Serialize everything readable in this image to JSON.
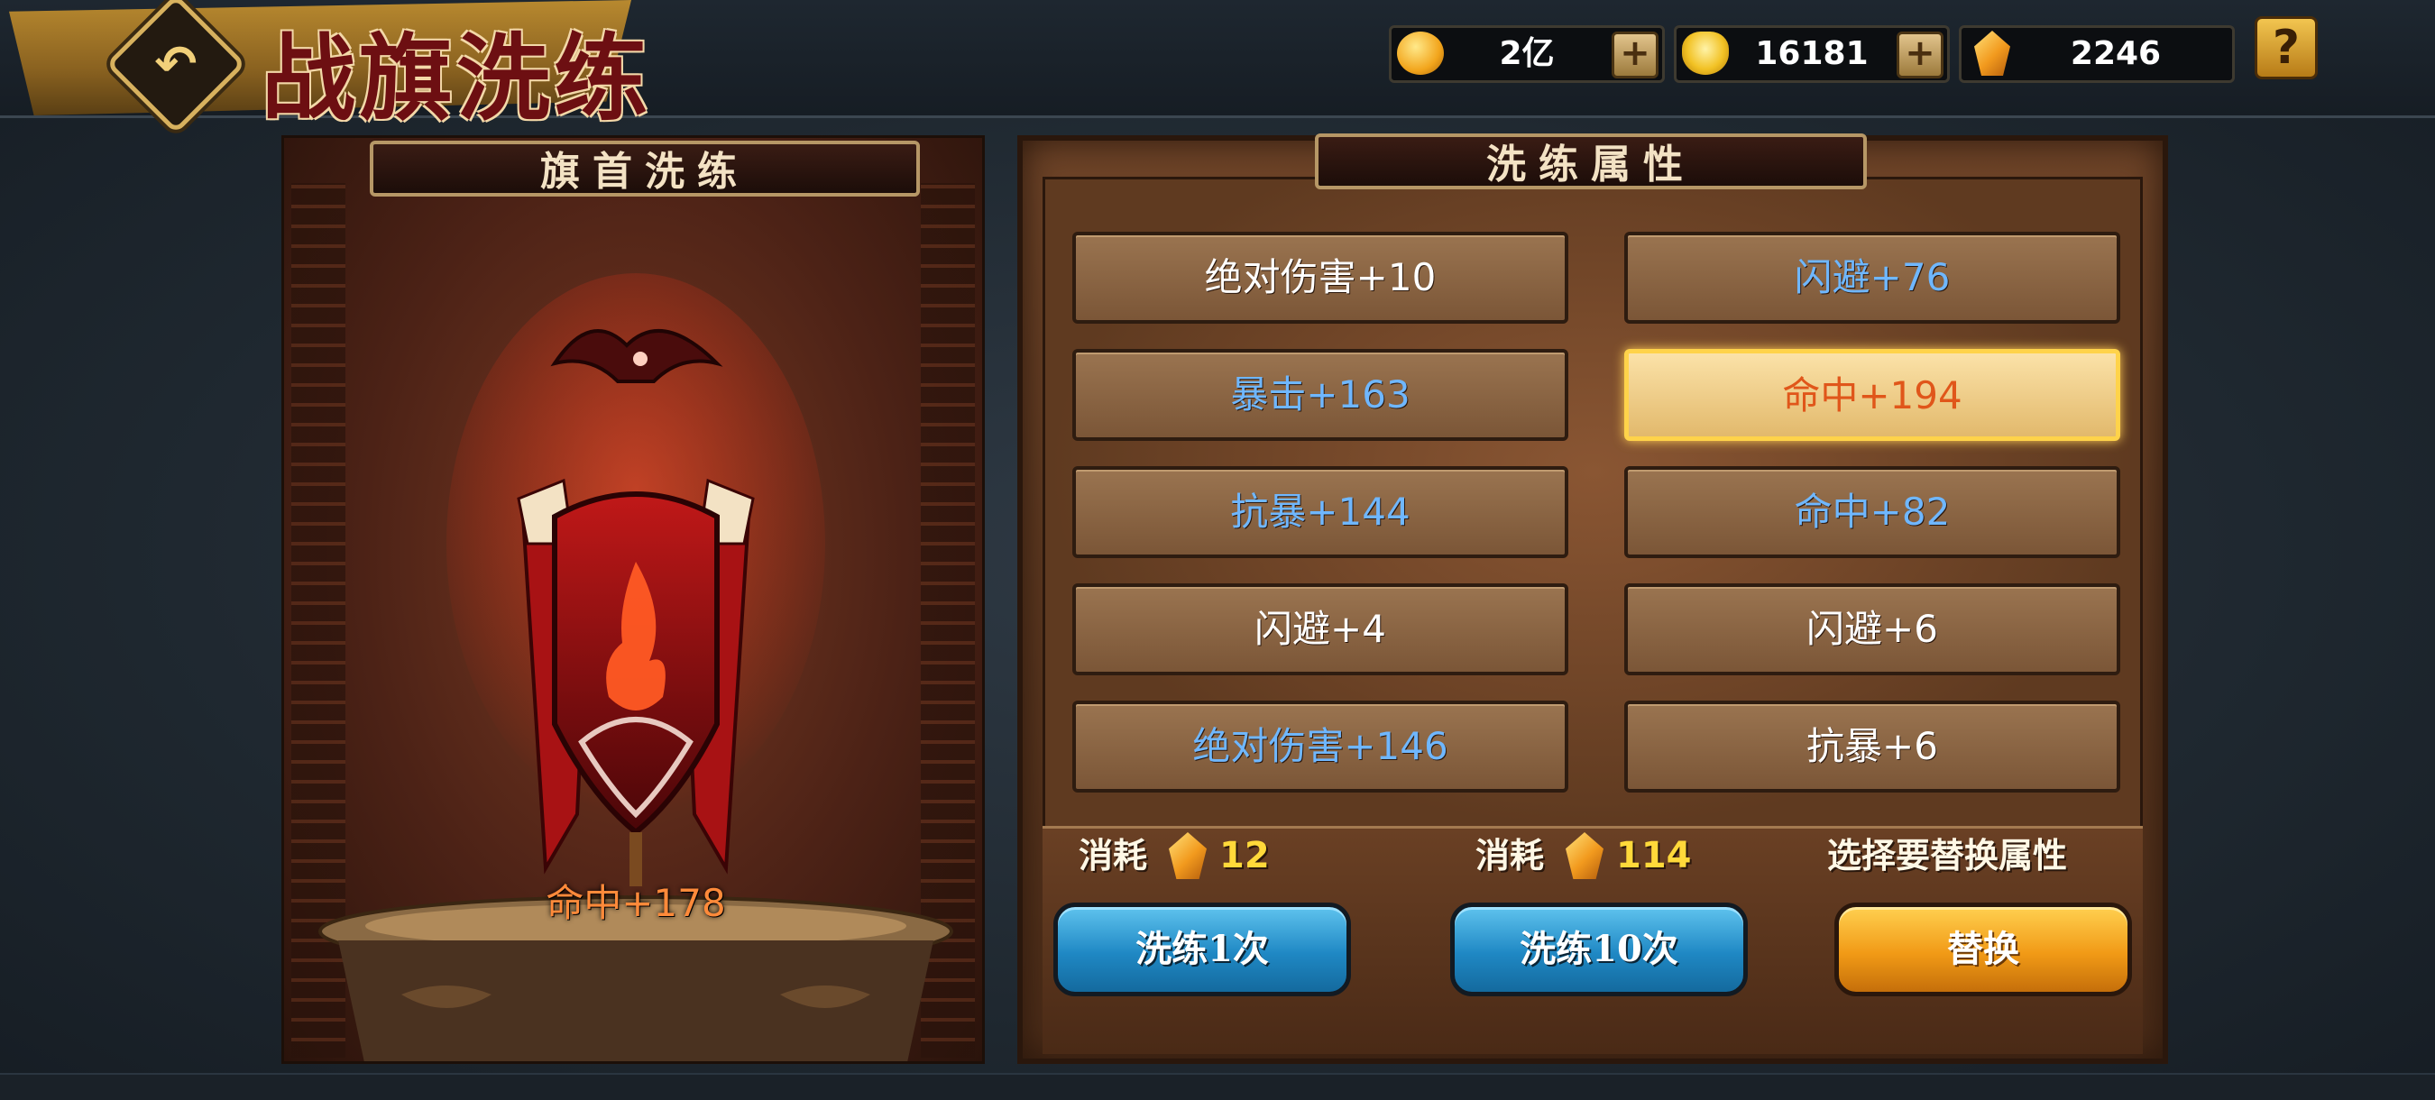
{
  "header": {
    "title": "战旗洗练",
    "currencies": [
      {
        "name": "gold-coin-icon",
        "value": "2亿",
        "has_add": true
      },
      {
        "name": "gold-ingot-icon",
        "value": "16181",
        "has_add": true
      },
      {
        "name": "flag-gem-icon",
        "value": "2246",
        "has_add": false
      }
    ],
    "help_label": "?"
  },
  "left_panel": {
    "tab_label": "旗首洗练",
    "flag_stat": "命中+178"
  },
  "right_panel": {
    "tab_label": "洗练属性",
    "attributes": [
      {
        "text": "绝对伤害+10",
        "color": "#ffffff",
        "selected": false
      },
      {
        "text": "闪避+76",
        "color": "#6fb7ff",
        "selected": false
      },
      {
        "text": "暴击+163",
        "color": "#6fb7ff",
        "selected": false
      },
      {
        "text": "命中+194",
        "color": "#e0561a",
        "selected": true
      },
      {
        "text": "抗暴+144",
        "color": "#6fb7ff",
        "selected": false
      },
      {
        "text": "命中+82",
        "color": "#6fb7ff",
        "selected": false
      },
      {
        "text": "闪避+4",
        "color": "#ffffff",
        "selected": false
      },
      {
        "text": "闪避+6",
        "color": "#ffffff",
        "selected": false
      },
      {
        "text": "绝对伤害+146",
        "color": "#6fb7ff",
        "selected": false
      },
      {
        "text": "抗暴+6",
        "color": "#ffffff",
        "selected": false
      }
    ],
    "cost_1": {
      "label": "消耗",
      "value": "12"
    },
    "cost_10": {
      "label": "消耗",
      "value": "114"
    },
    "replace_hint": "选择要替换属性",
    "buttons": {
      "refine_once": "洗练1次",
      "refine_ten": "洗练10次",
      "replace": "替换"
    }
  }
}
